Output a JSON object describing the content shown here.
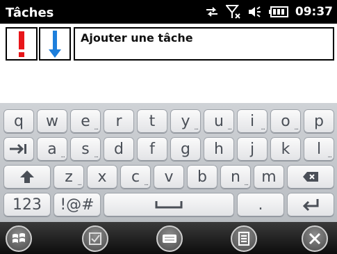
{
  "status": {
    "app_title": "Tâches",
    "time": "09:37",
    "icons": [
      "sync-arrows-icon",
      "no-signal-icon",
      "speaker-icon",
      "battery-icon"
    ]
  },
  "task": {
    "priority_high_icon": "exclamation-icon",
    "priority_low_icon": "down-arrow-icon",
    "input_value": "Ajouter une tâche"
  },
  "keyboard": {
    "row1": [
      {
        "label": "q"
      },
      {
        "label": "w"
      },
      {
        "label": "e",
        "alt": "..."
      },
      {
        "label": "r"
      },
      {
        "label": "t"
      },
      {
        "label": "y",
        "alt": "..."
      },
      {
        "label": "u",
        "alt": "..."
      },
      {
        "label": "i",
        "alt": "..."
      },
      {
        "label": "o",
        "alt": "..."
      },
      {
        "label": "p"
      }
    ],
    "row2": [
      {
        "label": "→|",
        "icon": "tab-icon"
      },
      {
        "label": "a",
        "alt": "..."
      },
      {
        "label": "s",
        "alt": "..."
      },
      {
        "label": "d"
      },
      {
        "label": "f"
      },
      {
        "label": "g"
      },
      {
        "label": "h"
      },
      {
        "label": "j"
      },
      {
        "label": "k"
      },
      {
        "label": "l",
        "alt": "..."
      }
    ],
    "row3": [
      {
        "label": "⬆",
        "icon": "shift-icon"
      },
      {
        "label": "z",
        "alt": "..."
      },
      {
        "label": "x"
      },
      {
        "label": "c",
        "alt": "..."
      },
      {
        "label": "v"
      },
      {
        "label": "b"
      },
      {
        "label": "n",
        "alt": "..."
      },
      {
        "label": "m"
      },
      {
        "label": "⌫",
        "icon": "backspace-icon"
      }
    ],
    "row4": [
      {
        "label": "123"
      },
      {
        "label": "!@#"
      },
      {
        "label": "",
        "icon": "space-icon"
      },
      {
        "label": "."
      },
      {
        "label": "↵",
        "icon": "enter-icon"
      }
    ]
  },
  "bottombar": {
    "buttons": [
      "windows-start-icon",
      "checkbox-icon",
      "keyboard-icon",
      "menu-icon",
      "close-icon"
    ]
  },
  "colors": {
    "priority_high": "#e8161a",
    "priority_low": "#1e7fdc",
    "key_text": "#4a4f57"
  }
}
